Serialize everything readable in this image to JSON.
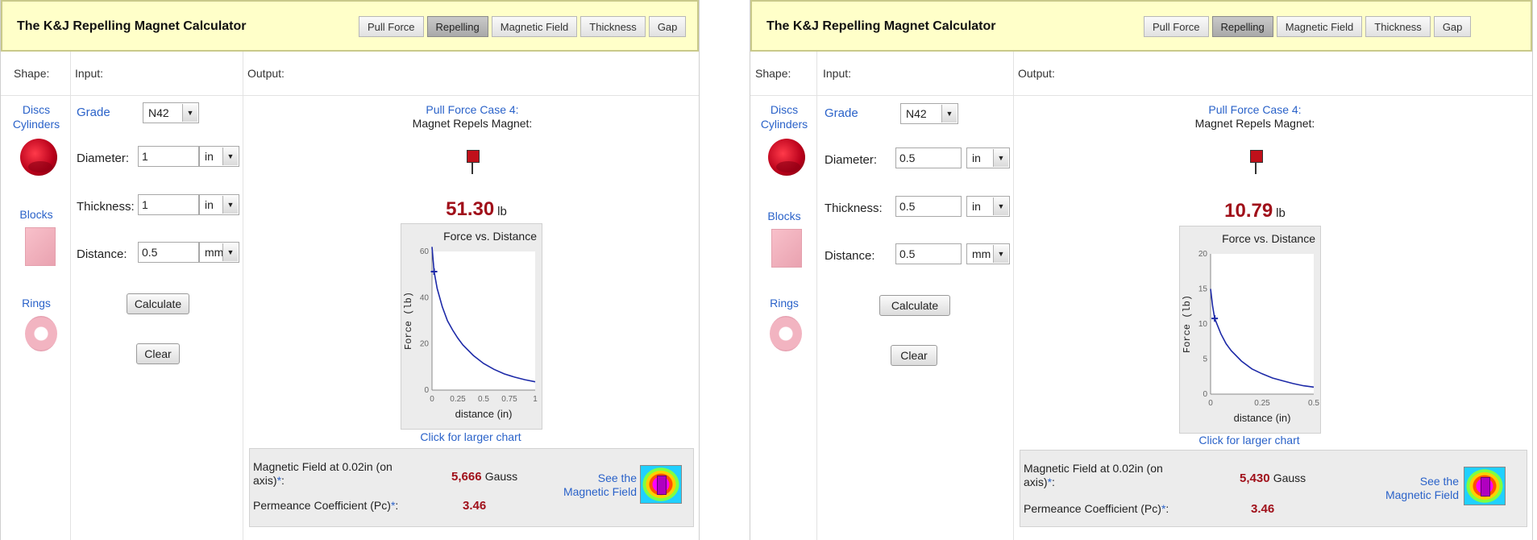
{
  "panels": [
    {
      "title": "The K&J Repelling Magnet Calculator",
      "tabs": [
        "Pull Force",
        "Repelling",
        "Magnetic Field",
        "Thickness",
        "Gap"
      ],
      "active_tab": "Repelling",
      "col_shape": "Shape:",
      "col_input": "Input:",
      "col_output": "Output:",
      "shapes": {
        "discs": "Discs",
        "cylinders": "Cylinders",
        "blocks": "Blocks",
        "rings": "Rings"
      },
      "grade_label": "Grade",
      "grade_value": "N42",
      "diameter_label": "Diameter:",
      "diameter_value": "1",
      "diameter_unit": "in",
      "thickness_label": "Thickness:",
      "thickness_value": "1",
      "thickness_unit": "in",
      "distance_label": "Distance:",
      "distance_value": "0.5",
      "distance_unit": "mm",
      "calculate_label": "Calculate",
      "clear_label": "Clear",
      "case_line1": "Pull Force Case 4:",
      "case_line2": "Magnet Repels Magnet:",
      "force_value": "51.30",
      "force_unit": "lb",
      "chart_link": "Click for larger chart",
      "field_label": "Magnetic Field at 0.02in (on axis)",
      "field_value": "5,666",
      "field_unit": "Gauss",
      "pc_label": "Permeance Coefficient (Pc)",
      "pc_value": "3.46",
      "see_field_1": "See the",
      "see_field_2": "Magnetic Field",
      "asterisk": "*",
      "colon": ":"
    },
    {
      "title": "The K&J Repelling Magnet Calculator",
      "tabs": [
        "Pull Force",
        "Repelling",
        "Magnetic Field",
        "Thickness",
        "Gap"
      ],
      "active_tab": "Repelling",
      "col_shape": "Shape:",
      "col_input": "Input:",
      "col_output": "Output:",
      "shapes": {
        "discs": "Discs",
        "cylinders": "Cylinders",
        "blocks": "Blocks",
        "rings": "Rings"
      },
      "grade_label": "Grade",
      "grade_value": "N42",
      "diameter_label": "Diameter:",
      "diameter_value": "0.5",
      "diameter_unit": "in",
      "thickness_label": "Thickness:",
      "thickness_value": "0.5",
      "thickness_unit": "in",
      "distance_label": "Distance:",
      "distance_value": "0.5",
      "distance_unit": "mm",
      "calculate_label": "Calculate",
      "clear_label": "Clear",
      "case_line1": "Pull Force Case 4:",
      "case_line2": "Magnet Repels Magnet:",
      "force_value": "10.79",
      "force_unit": "lb",
      "chart_link": "Click for larger chart",
      "field_label": "Magnetic Field at 0.02in (on axis)",
      "field_value": "5,430",
      "field_unit": "Gauss",
      "pc_label": "Permeance Coefficient (Pc)",
      "pc_value": "3.46",
      "see_field_1": "See the",
      "see_field_2": "Magnetic Field",
      "asterisk": "*",
      "colon": ":"
    }
  ],
  "chart_data": [
    {
      "type": "line",
      "title": "Force vs. Distance",
      "xlabel": "distance (in)",
      "ylabel": "Force (lb)",
      "xlim": [
        0,
        1
      ],
      "ylim": [
        0,
        60
      ],
      "xticks": [
        "0",
        "0.25",
        "0.5",
        "0.75",
        "1"
      ],
      "yticks": [
        "0",
        "20",
        "40",
        "60"
      ],
      "x": [
        0,
        0.02,
        0.05,
        0.1,
        0.15,
        0.2,
        0.25,
        0.3,
        0.4,
        0.5,
        0.6,
        0.7,
        0.8,
        0.9,
        1.0
      ],
      "y": [
        62,
        51.3,
        44,
        36,
        30,
        26,
        22.5,
        19.5,
        15,
        11.5,
        9,
        7,
        5.6,
        4.5,
        3.6
      ],
      "marker": {
        "x": 0.02,
        "y": 51.3
      }
    },
    {
      "type": "line",
      "title": "Force vs. Distance",
      "xlabel": "distance (in)",
      "ylabel": "Force (lb)",
      "xlim": [
        0,
        0.5
      ],
      "ylim": [
        0,
        20
      ],
      "xticks": [
        "0",
        "0.25",
        "0.5"
      ],
      "yticks": [
        "0",
        "5",
        "10",
        "15",
        "20"
      ],
      "x": [
        0,
        0.01,
        0.02,
        0.05,
        0.075,
        0.1,
        0.15,
        0.2,
        0.25,
        0.3,
        0.35,
        0.4,
        0.45,
        0.5
      ],
      "y": [
        15,
        12.5,
        10.79,
        8.6,
        7.2,
        6.2,
        4.7,
        3.6,
        2.9,
        2.3,
        1.9,
        1.5,
        1.2,
        1.0
      ],
      "marker": {
        "x": 0.02,
        "y": 10.79
      }
    }
  ]
}
